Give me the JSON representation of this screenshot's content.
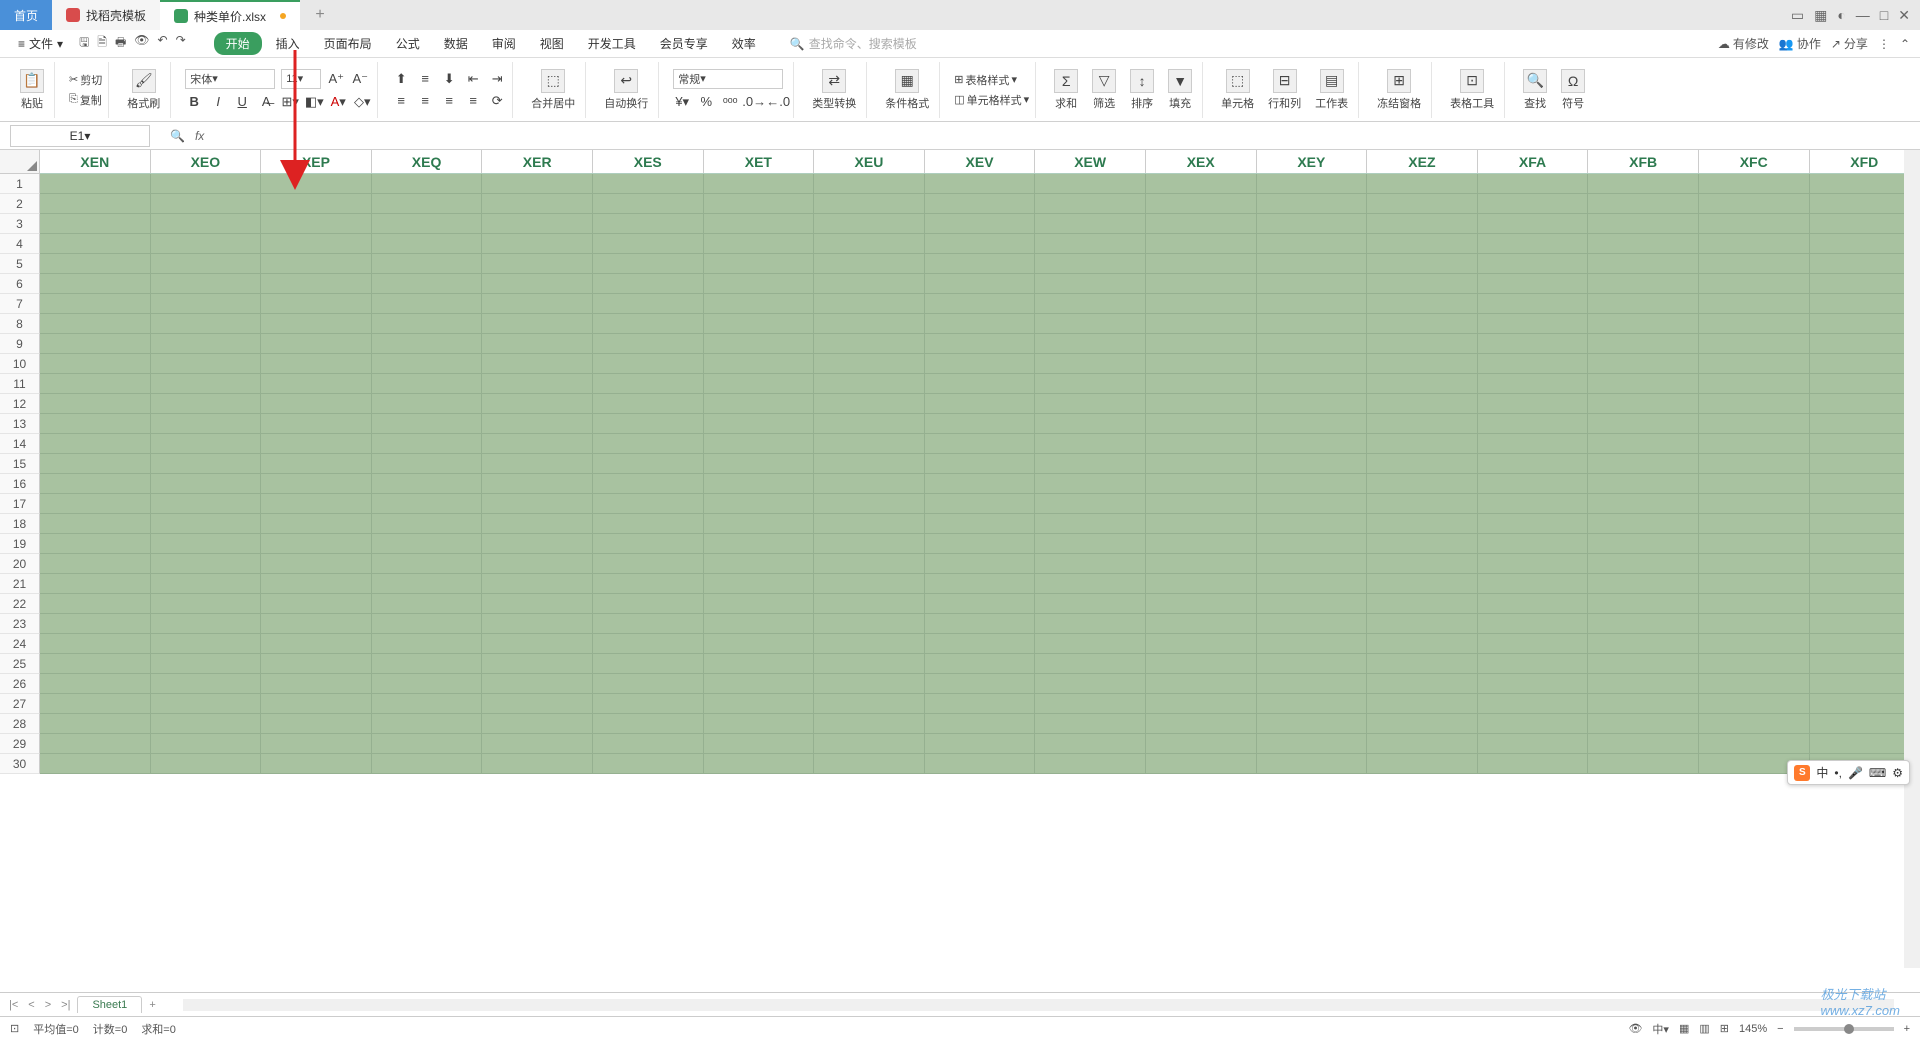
{
  "tabs": {
    "home": "首页",
    "template": "找稻壳模板",
    "file": "种类单价.xlsx"
  },
  "file_menu": "文件",
  "ribbon_tabs": [
    "开始",
    "插入",
    "页面布局",
    "公式",
    "数据",
    "审阅",
    "视图",
    "开发工具",
    "会员专享",
    "效率"
  ],
  "search_placeholder": "查找命令、搜索模板",
  "right_links": {
    "modify": "有修改",
    "collab": "协作",
    "share": "分享"
  },
  "clipboard": {
    "paste": "粘贴",
    "cut": "剪切",
    "copy": "复制",
    "format": "格式刷"
  },
  "font": {
    "name": "宋体",
    "size": "11"
  },
  "number_format": "常规",
  "align_group": {
    "merge": "合并居中",
    "wrap": "自动换行"
  },
  "type_convert": "类型转换",
  "cond_fmt": "条件格式",
  "table_style": "表格样式",
  "cell_style": "单元格样式",
  "ops": {
    "sum": "求和",
    "filter": "筛选",
    "sort": "排序",
    "fill": "填充",
    "cell": "单元格",
    "rowcol": "行和列",
    "sheet": "工作表",
    "freeze": "冻结窗格",
    "tabletool": "表格工具",
    "find": "查找",
    "symbol": "符号"
  },
  "namebox": "E1",
  "columns": [
    "XEN",
    "XEO",
    "XEP",
    "XEQ",
    "XER",
    "XES",
    "XET",
    "XEU",
    "XEV",
    "XEW",
    "XEX",
    "XEY",
    "XEZ",
    "XFA",
    "XFB",
    "XFC",
    "XFD"
  ],
  "row_count": 30,
  "sheet_name": "Sheet1",
  "status": {
    "avg": "平均值=0",
    "count": "计数=0",
    "sum": "求和=0",
    "zoom": "145%"
  },
  "ime": "中",
  "watermark_site": "www.xz7.com",
  "watermark_name": "极光下载站"
}
